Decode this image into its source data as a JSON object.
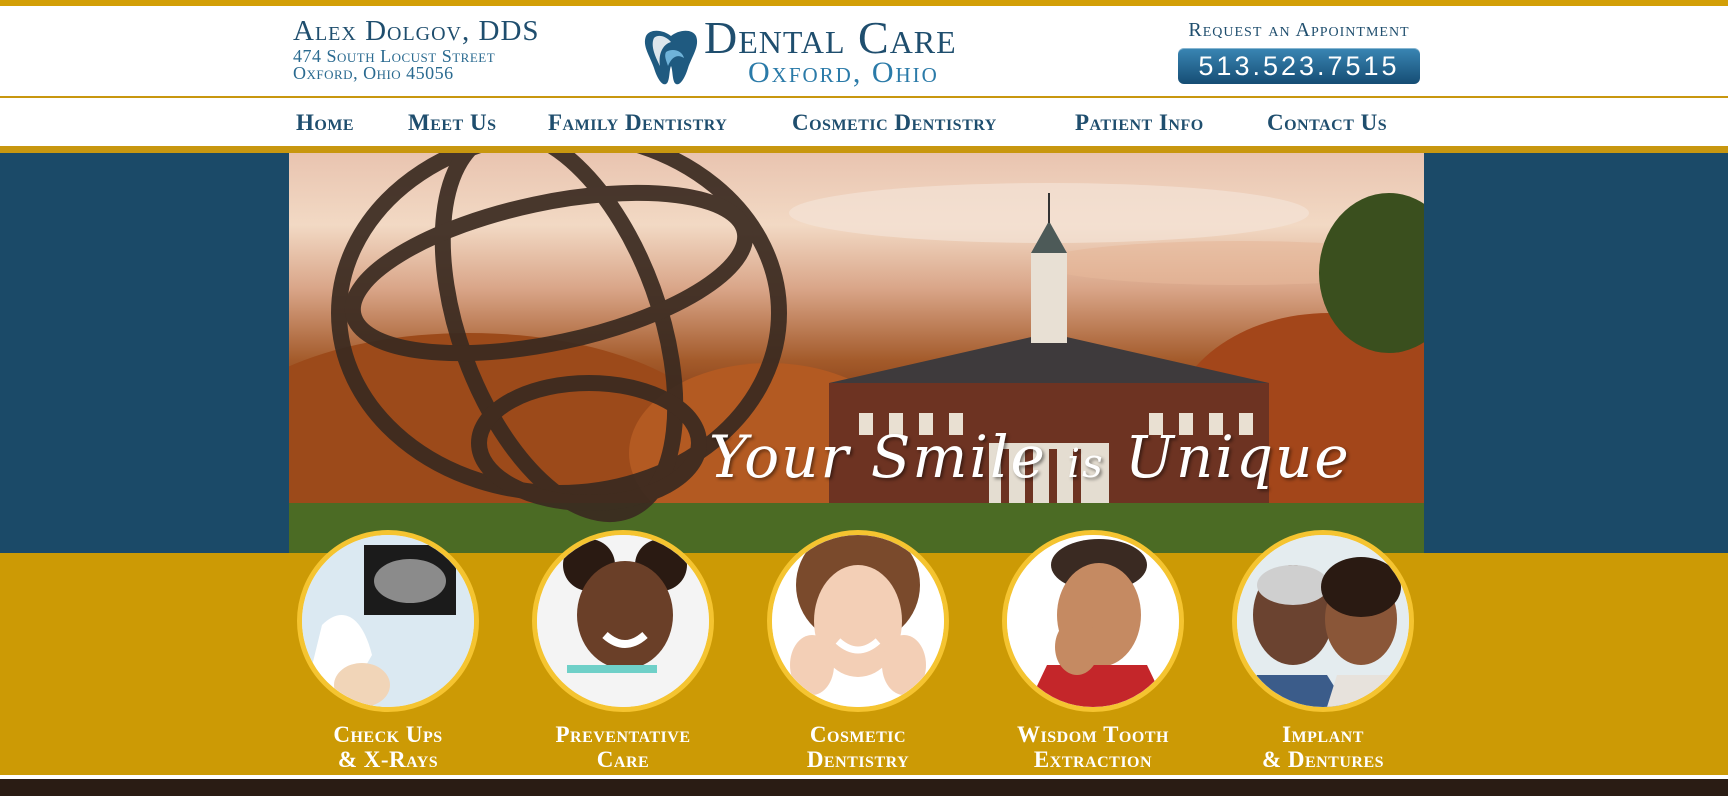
{
  "doctor": {
    "name": "Alex Dolgov, DDS",
    "address_line1": "474 South Locust Street",
    "address_line2": "Oxford, Ohio 45056"
  },
  "logo": {
    "title": "Dental Care",
    "subtitle": "Oxford, Ohio"
  },
  "appointment": {
    "label": "Request an Appointment",
    "phone": "513.523.7515"
  },
  "nav": {
    "items": [
      {
        "label": "Home"
      },
      {
        "label": "Meet Us"
      },
      {
        "label": "Family Dentistry"
      },
      {
        "label": "Cosmetic Dentistry"
      },
      {
        "label": "Patient Info"
      },
      {
        "label": "Contact Us"
      }
    ]
  },
  "hero": {
    "tagline_part1": "Your",
    "tagline_part2": "Smile",
    "tagline_part3": "is",
    "tagline_part4": "Unique"
  },
  "services": [
    {
      "label": "Check Ups\n& X-Rays",
      "icon": "xray-photo"
    },
    {
      "label": "Preventative\nCare",
      "icon": "child-brushing-photo"
    },
    {
      "label": "Cosmetic\nDentistry",
      "icon": "smiling-woman-photo"
    },
    {
      "label": "Wisdom Tooth\nExtraction",
      "icon": "toothache-man-photo"
    },
    {
      "label": "Implant\n& Dentures",
      "icon": "senior-couple-photo"
    }
  ],
  "colors": {
    "gold": "#cc9a05",
    "navy": "#1b4a68",
    "text_blue": "#1f4e6e",
    "ring_gold": "#f5c430"
  }
}
